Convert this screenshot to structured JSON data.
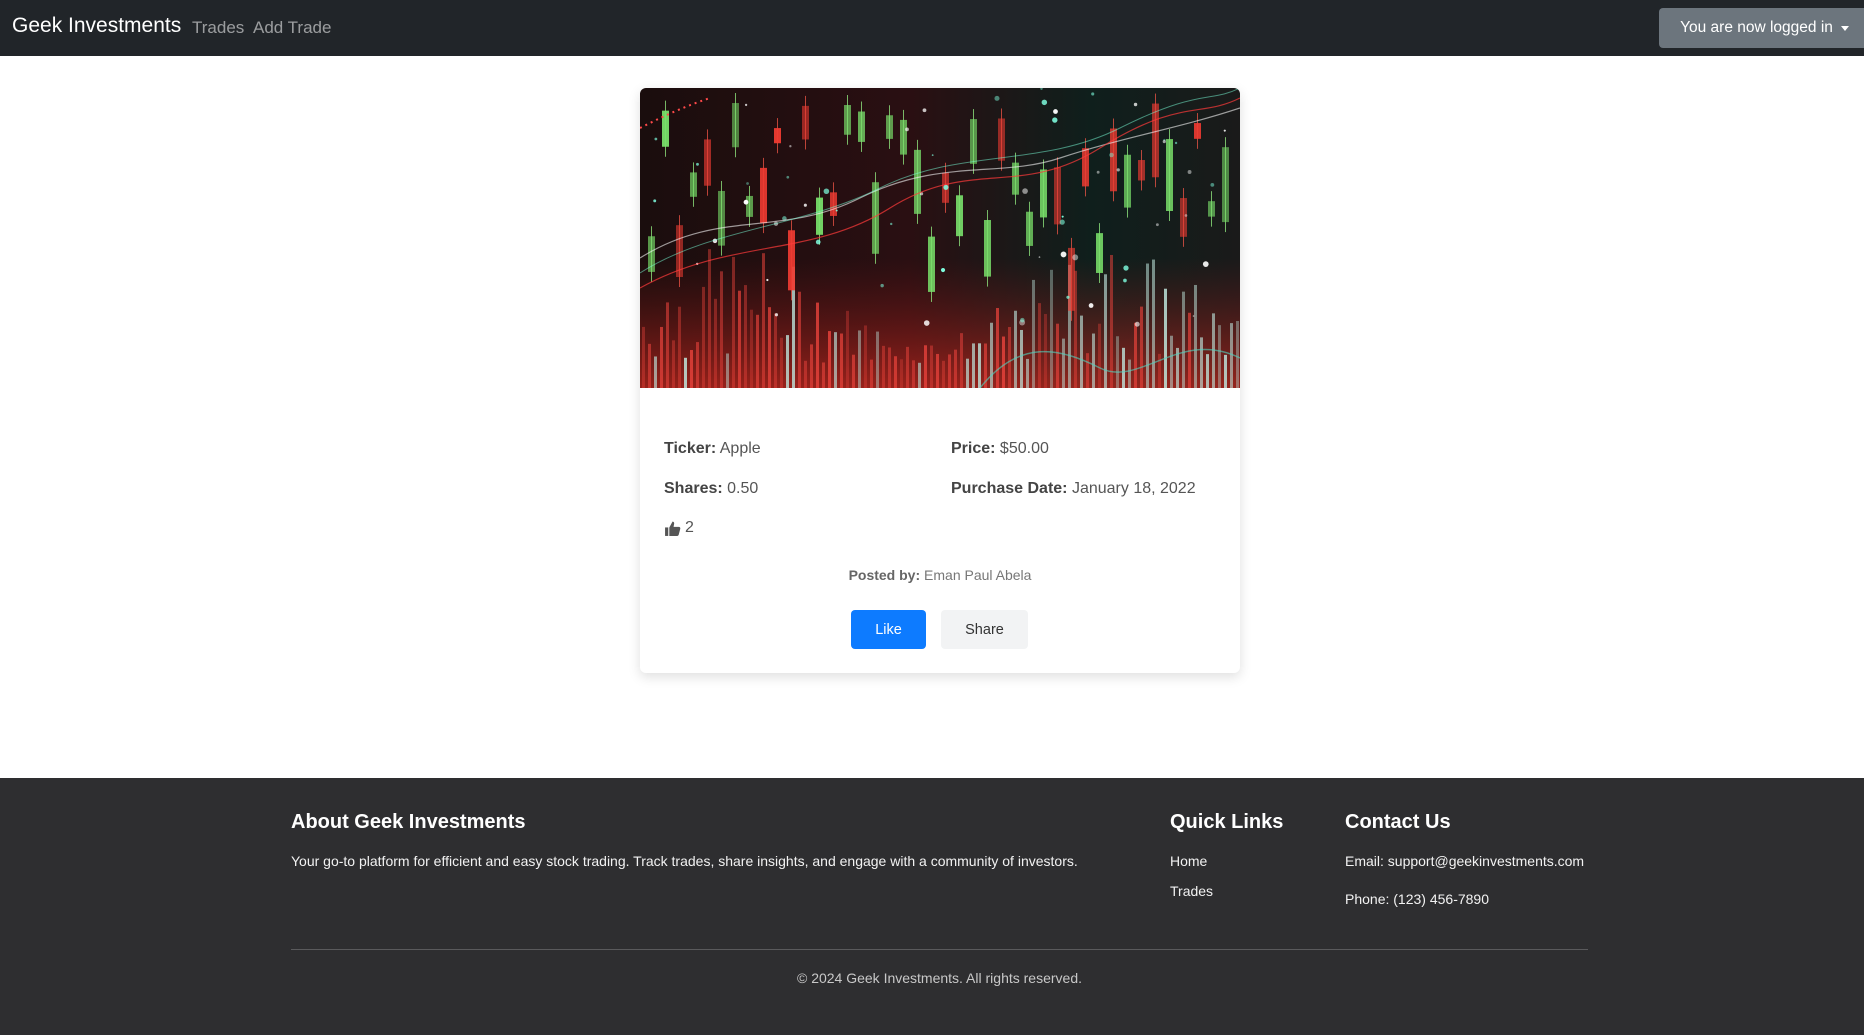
{
  "navbar": {
    "brand": "Geek Investments",
    "links": [
      "Trades",
      "Add Trade"
    ],
    "user_menu_label": "You are now logged in"
  },
  "trade": {
    "image_icon": "stock-chart-image",
    "ticker_label": "Ticker:",
    "ticker": "Apple",
    "price_label": "Price:",
    "price": "$50.00",
    "shares_label": "Shares:",
    "shares": "0.50",
    "date_label": "Purchase Date:",
    "date": "January 18, 2022",
    "likes": "2",
    "posted_label": "Posted by:",
    "posted_by": "Eman Paul Abela",
    "like_button": "Like",
    "share_button": "Share"
  },
  "footer": {
    "about_title": "About Geek Investments",
    "about_text": "Your go-to platform for efficient and easy stock trading. Track trades, share insights, and engage with a community of investors.",
    "links_title": "Quick Links",
    "links": [
      "Home",
      "Trades"
    ],
    "contact_title": "Contact Us",
    "email": "Email: support@geekinvestments.com",
    "phone": "Phone: (123) 456-7890",
    "copyright": "© 2024 Geek Investments. All rights reserved."
  },
  "colors": {
    "navbar_bg": "#212529",
    "primary": "#0d7bff",
    "secondary": "#6c757d",
    "footer_bg": "#2e2e30"
  }
}
